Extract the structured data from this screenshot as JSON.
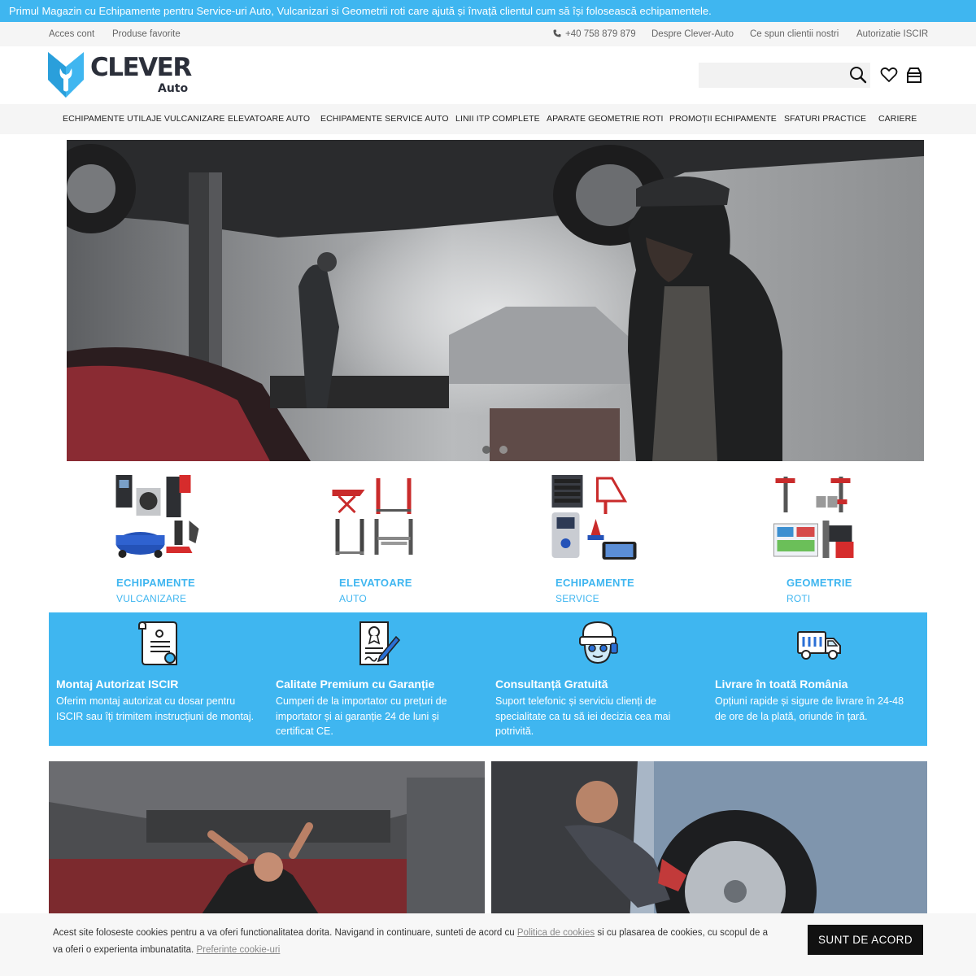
{
  "announcement": "Primul Magazin cu Echipamente pentru Service-uri Auto, Vulcanizari si Geometrii roti care ajută și învață clientul cum să își folosească echipamentele.",
  "utility": {
    "left_links": [
      "Acces cont",
      "Produse favorite"
    ],
    "phone": "+40 758 879 879",
    "right_links": [
      "Despre Clever-Auto",
      "Ce spun clientii nostri",
      "Autorizatie ISCIR"
    ]
  },
  "logo": {
    "name": "CLEVER",
    "sub": "Auto"
  },
  "search": {
    "placeholder": ""
  },
  "icons": {
    "search": "search-icon",
    "wishlist": "heart-icon",
    "cart": "bag-icon",
    "phone": "phone-icon"
  },
  "nav": {
    "items": [
      "ECHIPAMENTE UTILAJE VULCANIZARE",
      "ELEVATOARE AUTO",
      "ECHIPAMENTE SERVICE AUTO",
      "LINII ITP COMPLETE",
      "APARATE GEOMETRIE ROTI",
      "PROMOȚII ECHIPAMENTE",
      "SFATURI PRACTICE",
      "CARIERE"
    ]
  },
  "hero": {
    "slides": 2,
    "active_slide": 1
  },
  "categories": [
    {
      "title": "ECHIPAMENTE",
      "sub": "VULCANIZARE"
    },
    {
      "title": "ELEVATOARE",
      "sub": "AUTO"
    },
    {
      "title": "ECHIPAMENTE",
      "sub": "SERVICE"
    },
    {
      "title": "GEOMETRIE",
      "sub": "ROTI"
    }
  ],
  "features": [
    {
      "title": "Montaj Autorizat ISCIR",
      "desc": "Oferim montaj autorizat cu dosar pentru ISCIR sau îți trimitem instrucțiuni de montaj.",
      "icon": "document-icon"
    },
    {
      "title": "Calitate Premium cu Garanție",
      "desc": "Cumperi de la importator cu prețuri de importator și ai garanție 24 de luni și certificat CE.",
      "icon": "certificate-icon"
    },
    {
      "title": "Consultanță Gratuită",
      "desc": "Suport telefonic și serviciu clienți de specialitate ca tu să iei decizia cea mai potrivită.",
      "icon": "support-agent-icon"
    },
    {
      "title": "Livrare în toată România",
      "desc": "Opțiuni rapide și sigure de livrare în 24-48 de ore de la plată, oriunde în țară.",
      "icon": "truck-icon"
    }
  ],
  "cookie": {
    "text_1": "Acest site foloseste cookies pentru a va oferi functionalitatea dorita. Navigand in continuare, sunteti de acord cu ",
    "link_1": "Politica de cookies",
    "text_2": " si cu plasarea de cookies, cu scopul de a va oferi o experienta imbunatatita. ",
    "link_2": "Preferinte cookie-uri",
    "button": "SUNT DE ACORD"
  },
  "colors": {
    "accent": "#3fb6f0",
    "dark": "#2b2f3a",
    "button": "#111111"
  }
}
